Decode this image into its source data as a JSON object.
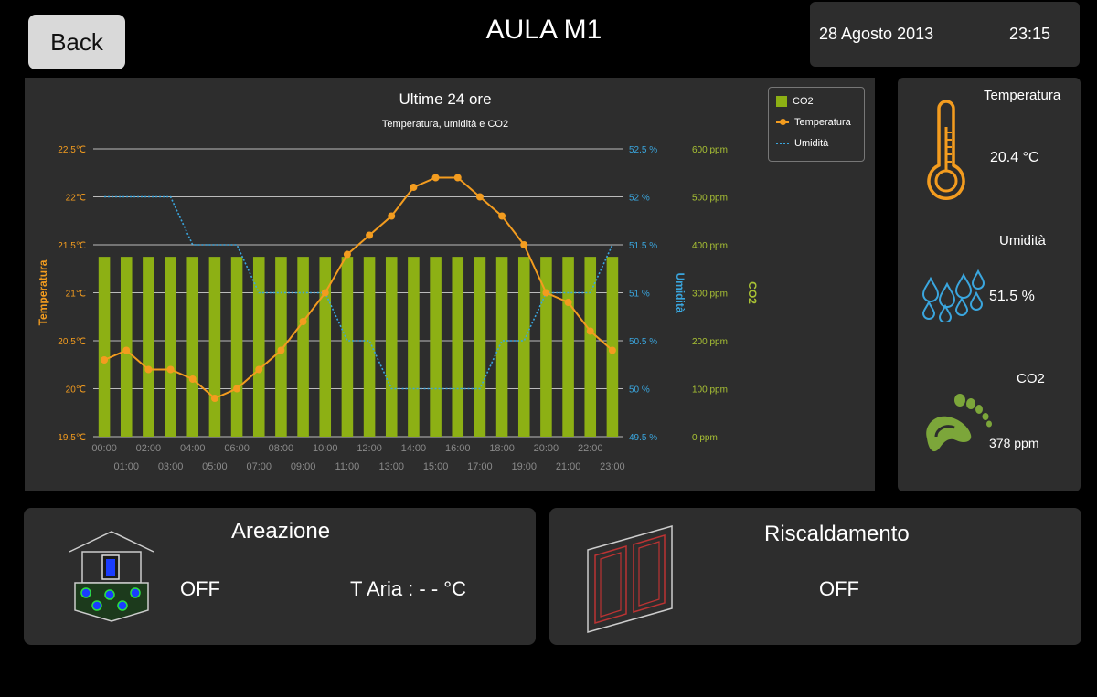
{
  "header": {
    "back_label": "Back",
    "room_title": "AULA M1",
    "date": "28 Agosto 2013",
    "time": "23:15"
  },
  "chart_panel": {
    "title": "Ultime 24 ore",
    "subtitle": "Temperatura, umidità e CO2",
    "legend": [
      "CO2",
      "Temperatura",
      "Umidità"
    ]
  },
  "chart_data": {
    "type": "bar+line",
    "title": "Ultime 24 ore",
    "subtitle": "Temperatura, umidità e CO2",
    "categories": [
      "00:00",
      "01:00",
      "02:00",
      "03:00",
      "04:00",
      "05:00",
      "06:00",
      "07:00",
      "08:00",
      "09:00",
      "10:00",
      "11:00",
      "12:00",
      "13:00",
      "14:00",
      "15:00",
      "16:00",
      "17:00",
      "18:00",
      "19:00",
      "20:00",
      "21:00",
      "22:00",
      "23:00"
    ],
    "axes": {
      "temperatura": {
        "label": "Temperatura",
        "ylim": [
          19.5,
          22.5
        ],
        "ticks": [
          "19.5℃",
          "20℃",
          "20.5℃",
          "21℃",
          "21.5℃",
          "22℃",
          "22.5℃"
        ]
      },
      "umidita": {
        "label": "Umidità",
        "ylim": [
          49.5,
          52.5
        ],
        "ticks": [
          "49.5 %",
          "50 %",
          "50.5 %",
          "51 %",
          "51.5 %",
          "52 %",
          "52.5 %"
        ]
      },
      "co2": {
        "label": "CO2",
        "ylim": [
          0,
          600
        ],
        "ticks": [
          "0 ppm",
          "100 ppm",
          "200 ppm",
          "300 ppm",
          "400 ppm",
          "500 ppm",
          "600 ppm"
        ]
      }
    },
    "series": [
      {
        "name": "CO2",
        "kind": "bar",
        "axis": "co2",
        "color": "#8db014",
        "values": [
          375,
          375,
          375,
          375,
          375,
          375,
          375,
          375,
          375,
          375,
          375,
          375,
          375,
          375,
          375,
          375,
          375,
          375,
          375,
          375,
          375,
          375,
          375,
          375
        ]
      },
      {
        "name": "Temperatura",
        "kind": "line",
        "axis": "temperatura",
        "color": "#f39c1f",
        "values": [
          20.3,
          20.4,
          20.2,
          20.2,
          20.1,
          19.9,
          20.0,
          20.2,
          20.4,
          20.7,
          21.0,
          21.4,
          21.6,
          21.8,
          22.1,
          22.2,
          22.2,
          22.0,
          21.8,
          21.5,
          21.0,
          20.9,
          20.6,
          20.4
        ]
      },
      {
        "name": "Umidità",
        "kind": "line-dotted",
        "axis": "umidita",
        "color": "#3aa6de",
        "values": [
          52.0,
          52.0,
          52.0,
          52.0,
          51.5,
          51.5,
          51.5,
          51.0,
          51.0,
          51.0,
          51.0,
          50.5,
          50.5,
          50.0,
          50.0,
          50.0,
          50.0,
          50.0,
          50.5,
          50.5,
          51.0,
          51.0,
          51.0,
          51.5
        ]
      }
    ],
    "grid": true,
    "legend_position": "top-right"
  },
  "sensors": {
    "temperature_label": "Temperatura",
    "temperature_value": "20.4 °C",
    "humidity_label": "Umidità",
    "humidity_value": "51.5 %",
    "co2_label": "CO2",
    "co2_value": "378 ppm"
  },
  "ventilation": {
    "title": "Areazione",
    "status": "OFF",
    "air_temp": "T Aria : - - °C"
  },
  "heating": {
    "title": "Riscaldamento",
    "status": "OFF"
  },
  "colors": {
    "temperature": "#f39c1f",
    "humidity": "#3aa6de",
    "co2": "#8db014",
    "co2_axis": "#a9c234"
  }
}
